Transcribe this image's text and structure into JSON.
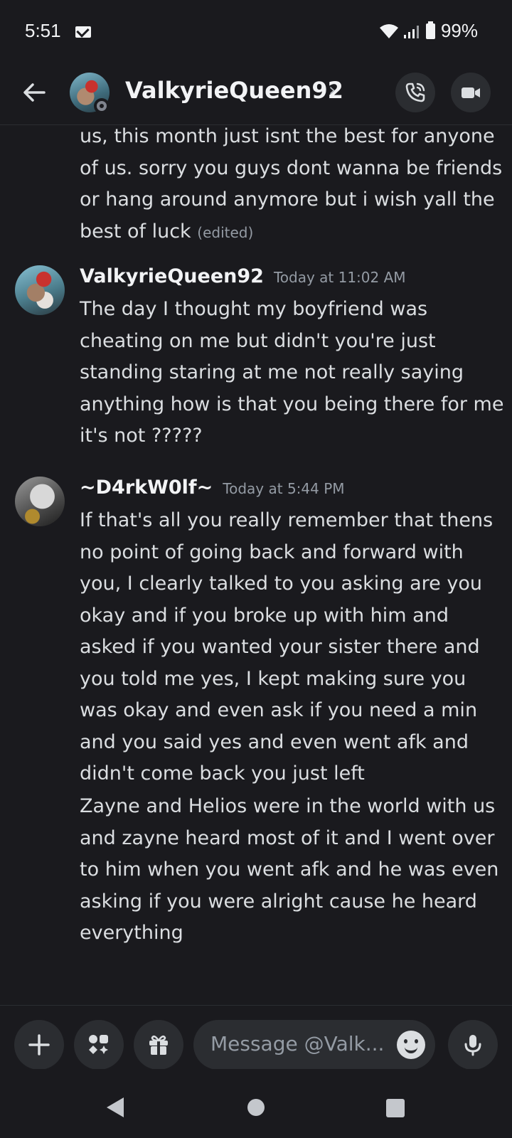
{
  "status_bar": {
    "time": "5:51",
    "battery": "99%",
    "icons": [
      "mail-icon",
      "wifi-icon",
      "signal-icon",
      "battery-icon"
    ]
  },
  "header": {
    "title": "ValkyrieQueen92",
    "chevron": "›",
    "icons": [
      "back-arrow-icon",
      "phone-call-icon",
      "video-camera-icon"
    ]
  },
  "messages": {
    "continued": {
      "text": "us, this month just isnt the best for anyone of us. sorry you guys dont wanna be friends or hang around anymore but i wish yall the best of luck",
      "edited": "(edited)"
    },
    "valk": {
      "author": "ValkyrieQueen92",
      "timestamp": "Today at 11:02 AM",
      "text": "The day I thought my boyfriend was cheating on me but didn't you're just standing staring at me not really saying anything how is that you being there for me it's not ?????"
    },
    "wolf": {
      "author": "~D4rkW0lf~",
      "timestamp": "Today at 5:44 PM",
      "text1": "If that's all you really remember that thens no point of going back and forward with you, I clearly talked to you asking are you okay and if you broke up with him and asked if you wanted your sister there and you told me yes, I kept making sure you was okay and even ask if you need a min and you said yes and even went afk and didn't come back you just left",
      "text2": "Zayne and Helios were in the world with us and zayne heard most of it and I went over to him when you went afk and he was even asking if you were alright cause he heard everything"
    }
  },
  "composer": {
    "placeholder": "Message @Valk...",
    "icons": [
      "plus-icon",
      "apps-icon",
      "gift-icon",
      "emoji-icon",
      "microphone-icon"
    ]
  },
  "nav": {
    "icons": [
      "nav-back-icon",
      "nav-home-icon",
      "nav-recents-icon"
    ]
  },
  "colors": {
    "background": "#1a1a1e",
    "surface": "#2b2d31",
    "text": "#dbdee1",
    "muted": "#949ba4"
  }
}
